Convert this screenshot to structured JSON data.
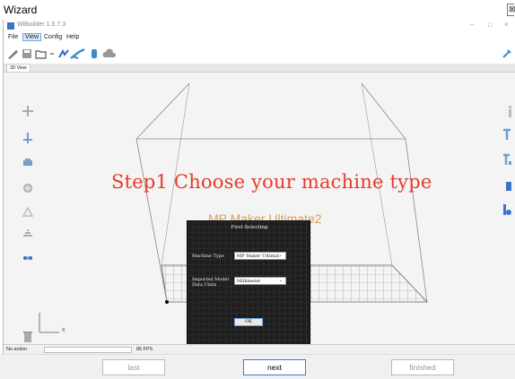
{
  "wizard": {
    "title": "Wizard"
  },
  "app": {
    "title": "Wiibuilder 1.5.7.3",
    "window_controls": {
      "minimize": "–",
      "maximize": "□",
      "close": "×"
    },
    "menu": [
      "File",
      "View",
      "Config",
      "Help"
    ],
    "selected_menu": "View",
    "tab": "3D View",
    "toolbar_icons": [
      "pencil-icon",
      "save-icon",
      "open-folder-icon",
      "arrow-icon",
      "tool-icon",
      "model-icon",
      "wrench-icon",
      "cloud-icon"
    ]
  },
  "view": {
    "step_text": "Step1 Choose your machine type",
    "ghost_text": "MP Maker Ultimate2",
    "axis_x": "x"
  },
  "dialog": {
    "title": "First Selecting",
    "machine_type_label": "Machine Type",
    "machine_type_value": "MP Maker Ultimat",
    "model_units_label_1": "Imported Model",
    "model_units_label_2": "Data Units",
    "model_units_value": "Millimeter",
    "ok_label": "OK"
  },
  "status": {
    "action": "No action",
    "fps": "86 FPS"
  },
  "footer": {
    "last": "last",
    "next": "next",
    "finished": "finished"
  },
  "colors": {
    "step_text": "#e63a2a",
    "accent": "#3b7ad9",
    "ghost_text": "#d4a05a"
  }
}
